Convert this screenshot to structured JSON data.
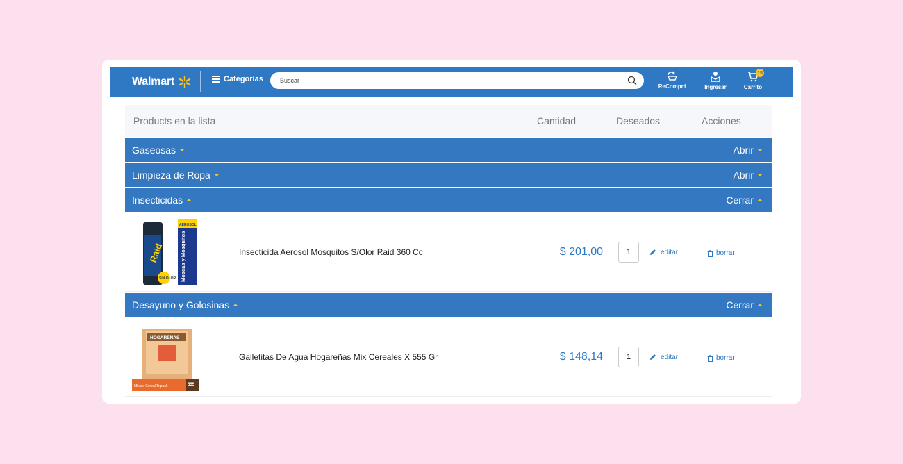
{
  "header": {
    "brand": "Walmart",
    "categories_label": "Categorías",
    "search_placeholder": "Buscar",
    "nav": [
      {
        "label": "ReComprá",
        "icon": "recompra-icon"
      },
      {
        "label": "Ingresar",
        "icon": "user-icon"
      },
      {
        "label": "Carrito",
        "icon": "cart-icon",
        "badge": "15"
      }
    ]
  },
  "list": {
    "columns": {
      "products": "Products en la lista",
      "quantity": "Cantidad",
      "wished": "Deseados",
      "actions": "Acciones"
    },
    "categories": [
      {
        "name": "Gaseosas",
        "toggle": "Abrir"
      },
      {
        "name": "Limpieza de Ropa",
        "toggle": "Abrir"
      },
      {
        "name": "Insecticidas",
        "toggle": "Cerrar"
      },
      {
        "name": "Desayuno y Golosinas",
        "toggle": "Cerrar"
      }
    ],
    "items": [
      {
        "name": "Insecticida Aerosol Mosquitos S/Olor Raid 360 Cc",
        "price": "$ 201,00",
        "quantity": "1",
        "edit_label": "editar",
        "delete_label": "borrar",
        "image_text": {
          "brand": "Raid",
          "side": "Moscas y Mosquitos",
          "top": "AEROSOL",
          "badge": "SIN OLOR"
        }
      },
      {
        "name": "Galletitas De Agua Hogareñas Mix Cereales X 555 Gr",
        "price": "$ 148,14",
        "quantity": "1",
        "edit_label": "editar",
        "delete_label": "borrar",
        "image_text": {
          "brand": "HOGAREÑAS",
          "bottom": "Mix de Cereal Tripack",
          "weight": "555"
        }
      }
    ]
  },
  "colors": {
    "brand_blue": "#2f78c4",
    "accent_yellow": "#ffc220",
    "background_pink": "#fde0ee"
  }
}
